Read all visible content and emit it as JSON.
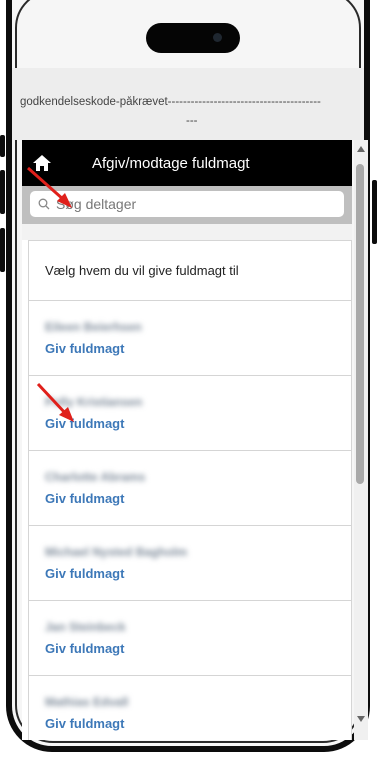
{
  "status": {
    "code_text": "godkendelseskode-påkrævet----------------------------------------",
    "code_continuation": "---"
  },
  "header": {
    "home_icon": "home-icon",
    "title": "Afgiv/modtage fuldmagt"
  },
  "search": {
    "icon": "search-icon",
    "placeholder": "Søg deltager"
  },
  "list": {
    "intro": "Vælg hvem du vil give fuldmagt til",
    "participants": [
      {
        "name": "Eileen Beierhsen",
        "action": "Giv fuldmagt"
      },
      {
        "name": "Polly Kristiansen",
        "action": "Giv fuldmagt"
      },
      {
        "name": "Charlotte Abrams",
        "action": "Giv fuldmagt"
      },
      {
        "name": "Michael Nysted Bagholm",
        "action": "Giv fuldmagt"
      },
      {
        "name": "Jan Steinbeck",
        "action": "Giv fuldmagt"
      },
      {
        "name": "Mathias Edvall",
        "action": "Giv fuldmagt"
      }
    ]
  },
  "colors": {
    "header_bg": "#000000",
    "link": "#3d78b8",
    "annotation_arrow": "#e0201b"
  }
}
